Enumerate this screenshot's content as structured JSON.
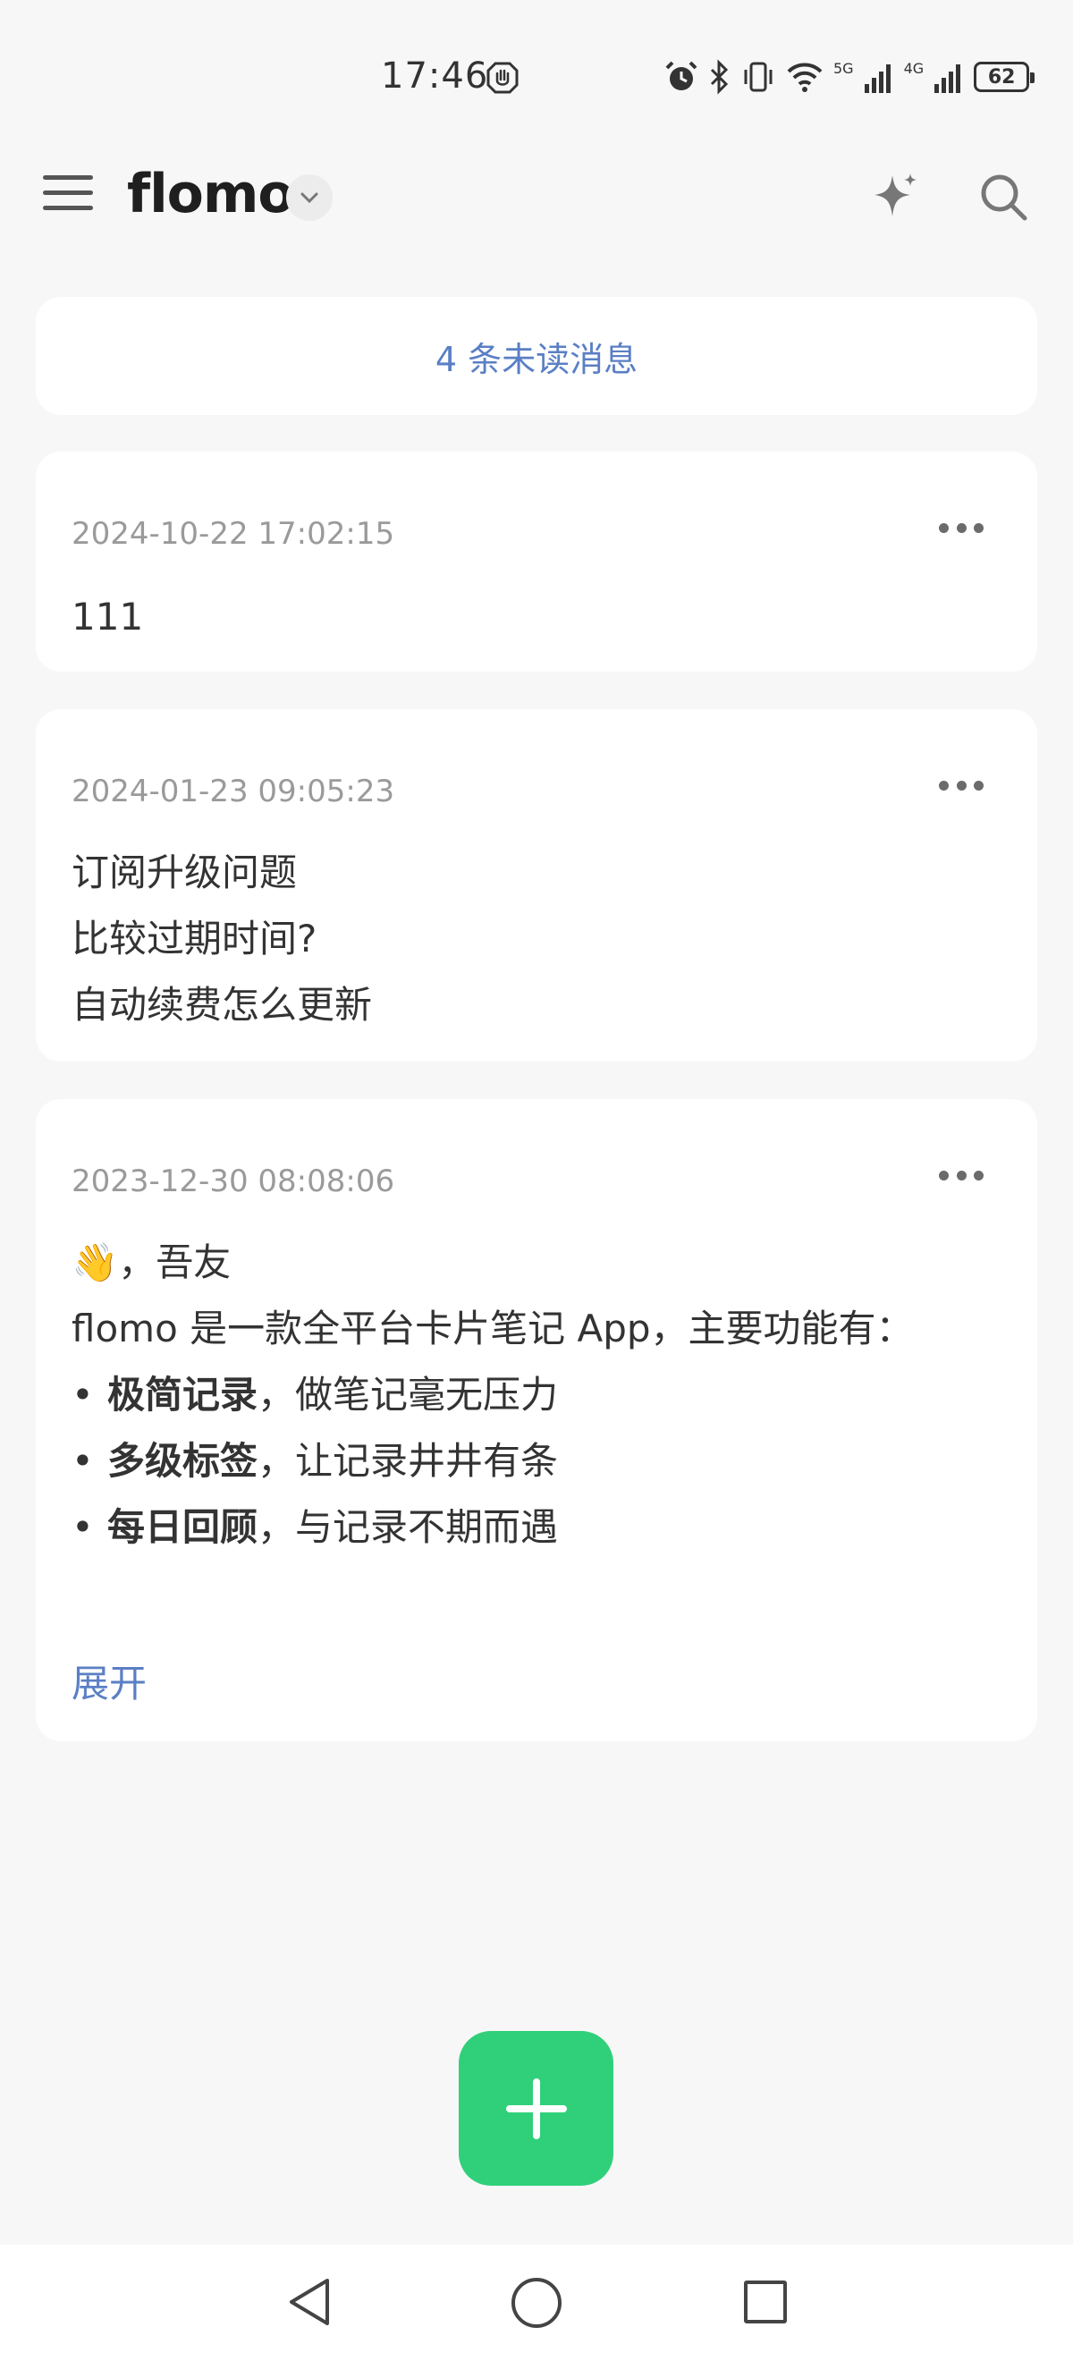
{
  "status_bar": {
    "time": "17:46",
    "net1": "5G",
    "net2": "4G",
    "battery": "62",
    "icons": [
      "hand-icon",
      "alarm-icon",
      "bluetooth-icon",
      "vibrate-icon",
      "wifi-icon",
      "signal-icon",
      "signal-icon",
      "battery-icon"
    ]
  },
  "header": {
    "title": "flomo",
    "icons": [
      "menu-icon",
      "chevron-down-icon",
      "sparkle-icon",
      "search-icon"
    ]
  },
  "unread_banner": {
    "label": "4 条未读消息",
    "color": "#5a7fc4"
  },
  "memos": [
    {
      "time": "2024-10-22 17:02:15",
      "lines": [
        "111"
      ]
    },
    {
      "time": "2024-01-23 09:05:23",
      "lines": [
        "订阅升级问题",
        "比较过期时间?",
        "自动续费怎么更新"
      ]
    },
    {
      "time": "2023-12-30 08:08:06",
      "greeting": "👋，吾友",
      "intro": "flomo 是一款全平台卡片笔记 App，主要功能有：",
      "bullets": [
        {
          "bold": "极简记录",
          "rest": "，做笔记毫无压力"
        },
        {
          "bold": "多级标签",
          "rest": "，让记录井井有条"
        },
        {
          "bold": "每日回顾",
          "rest": "，与记录不期而遇"
        }
      ],
      "bullet_char": "•",
      "expand_label": "展开"
    }
  ],
  "fab": {
    "icon": "plus-icon",
    "color": "#30d07a"
  },
  "system_nav": {
    "icons": [
      "back-icon",
      "home-icon",
      "recent-apps-icon"
    ]
  }
}
